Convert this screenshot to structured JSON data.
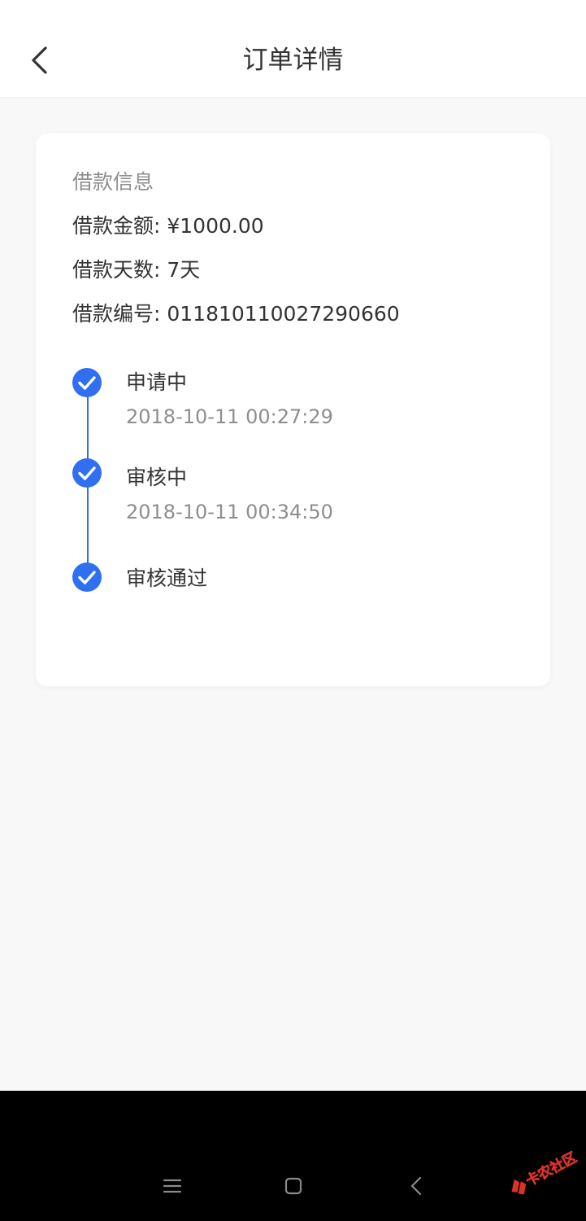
{
  "header": {
    "title": "订单详情"
  },
  "loan_info": {
    "section_title": "借款信息",
    "amount": "借款金额: ¥1000.00",
    "days": "借款天数: 7天",
    "number": "借款编号: 011810110027290660"
  },
  "timeline": [
    {
      "status": "申请中",
      "time": "2018-10-11 00:27:29"
    },
    {
      "status": "审核中",
      "time": "2018-10-11 00:34:50"
    },
    {
      "status": "审核通过"
    }
  ],
  "icons": {
    "back": "chevron-left-icon",
    "check": "check-circle-icon",
    "nav_menu": "menu-icon",
    "nav_home": "square-icon",
    "nav_back": "chevron-left-icon"
  },
  "colors": {
    "accent": "#2f6ff0",
    "text_primary": "#333333",
    "text_secondary": "#8e8e8e",
    "background": "#f8f8f8"
  },
  "watermark_text": "卡农社区"
}
